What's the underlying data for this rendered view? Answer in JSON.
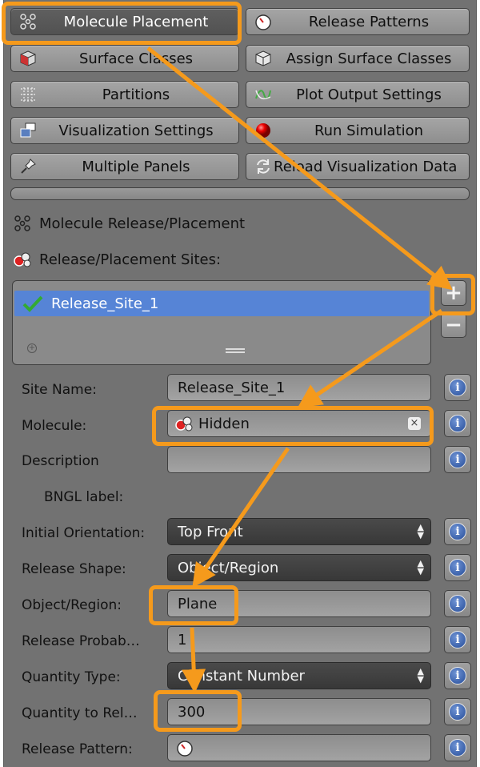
{
  "buttons": [
    {
      "label": "Molecule Placement",
      "icon": "molecule-grid-icon"
    },
    {
      "label": "Release Patterns",
      "icon": "stopwatch-icon"
    },
    {
      "label": "Surface Classes",
      "icon": "cube-icon"
    },
    {
      "label": "Assign Surface Classes",
      "icon": "object-icon"
    },
    {
      "label": "Partitions",
      "icon": "partition-grid-icon"
    },
    {
      "label": "Plot Output Settings",
      "icon": "plot-curve-icon"
    },
    {
      "label": "Visualization Settings",
      "icon": "display-icon"
    },
    {
      "label": "Run Simulation",
      "icon": "red-sphere-icon"
    },
    {
      "label": "Multiple Panels",
      "icon": "pin-icon"
    },
    {
      "label": "Reload Visualization Data",
      "icon": "reload-icon"
    }
  ],
  "section": {
    "title": "Molecule Release/Placement",
    "sites_label": "Release/Placement Sites:"
  },
  "list": {
    "items": [
      {
        "label": "Release_Site_1",
        "checked": true
      }
    ]
  },
  "properties": {
    "site_name": {
      "label": "Site Name:",
      "value": "Release_Site_1"
    },
    "molecule": {
      "label": "Molecule:",
      "value": "Hidden"
    },
    "description": {
      "label": "Description",
      "value": ""
    },
    "bngl_label": {
      "label": "BNGL label:"
    },
    "initial_orientation": {
      "label": "Initial Orientation:",
      "value": "Top Front"
    },
    "release_shape": {
      "label": "Release Shape:",
      "value": "Object/Region"
    },
    "object_region": {
      "label": "Object/Region:",
      "value": "Plane"
    },
    "release_probability": {
      "label": "Release Probab…",
      "value": "1"
    },
    "quantity_type": {
      "label": "Quantity Type:",
      "value": "Constant Number"
    },
    "quantity_to_release": {
      "label": "Quantity to Rel…",
      "value": "300"
    },
    "release_pattern": {
      "label": "Release Pattern:",
      "value": ""
    }
  },
  "colors": {
    "highlight": "#f59a1c",
    "selection": "#5684d6",
    "panel": "#727272"
  }
}
